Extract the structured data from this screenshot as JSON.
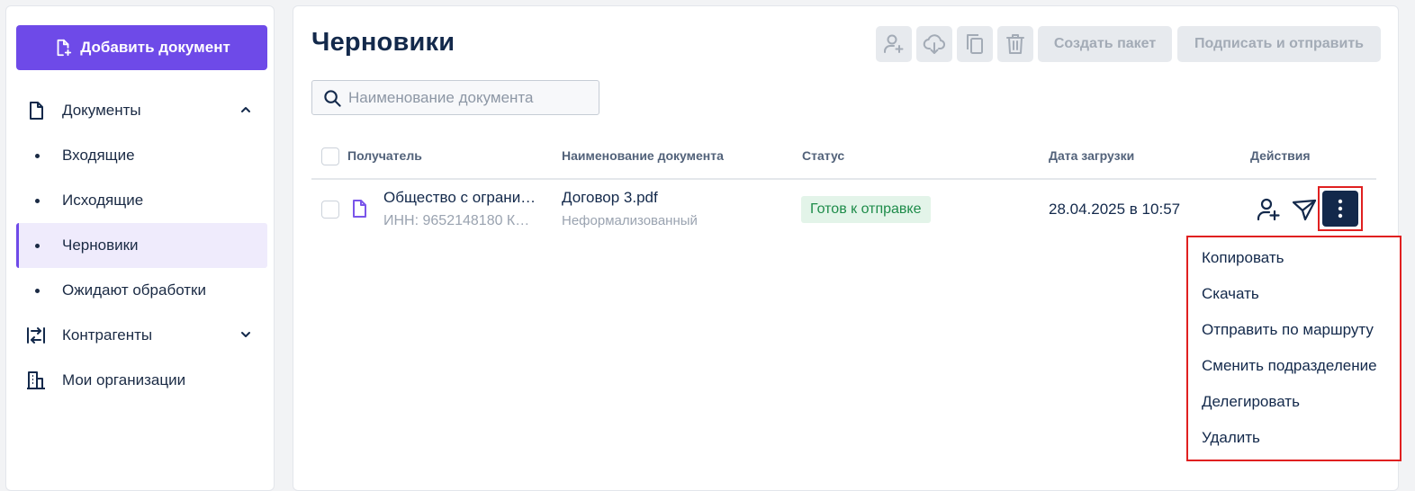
{
  "sidebar": {
    "add_button": "Добавить документ",
    "items": [
      {
        "label": "Документы",
        "icon": "document-icon"
      },
      {
        "label": "Входящие"
      },
      {
        "label": "Исходящие"
      },
      {
        "label": "Черновики",
        "active": true
      },
      {
        "label": "Ожидают обработки"
      },
      {
        "label": "Контрагенты",
        "icon": "counterparties-icon"
      },
      {
        "label": "Мои организации",
        "icon": "building-icon"
      }
    ]
  },
  "header": {
    "title": "Черновики",
    "create_package": "Создать пакет",
    "sign_and_send": "Подписать и отправить"
  },
  "search": {
    "placeholder": "Наименование документа",
    "value": ""
  },
  "table": {
    "columns": [
      "Получатель",
      "Наименование документа",
      "Статус",
      "Дата загрузки",
      "Действия"
    ],
    "rows": [
      {
        "recipient": "Общество с ограни…",
        "inn": "ИНН: 9652148180 К…",
        "doc_name": "Договор 3.pdf",
        "doc_type": "Неформализованный",
        "status": "Готов к отправке",
        "uploaded": "28.04.2025 в 10:57"
      }
    ]
  },
  "menu": {
    "items": [
      "Копировать",
      "Скачать",
      "Отправить по маршруту",
      "Сменить подразделение",
      "Делегировать",
      "Удалить"
    ]
  },
  "colors": {
    "accent": "#6e4ae8",
    "navy": "#13294b",
    "status_bg": "#e3f4e9",
    "status_text": "#1e8c4a",
    "highlight": "#e02020"
  }
}
